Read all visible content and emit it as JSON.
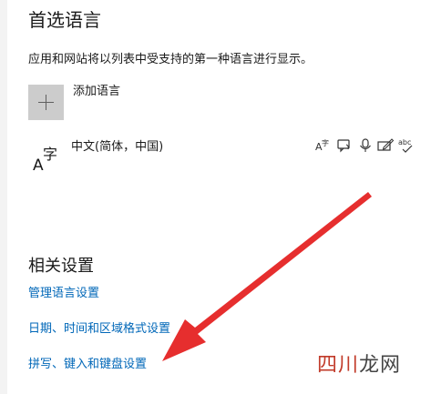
{
  "preferred_languages": {
    "title": "首选语言",
    "description": "应用和网站将以列表中受支持的第一种语言进行显示。",
    "add_language_label": "添加语言"
  },
  "language_item": {
    "name": "中文(简体，中国)",
    "icon_glyphs": {
      "latin": "A",
      "cjk": "字"
    },
    "feature_icons": [
      "display-language-icon",
      "speech-icon",
      "voice-input-icon",
      "handwriting-icon",
      "spellcheck-icon"
    ]
  },
  "related_settings": {
    "title": "相关设置",
    "links": [
      "管理语言设置",
      "日期、时间和区域格式设置",
      "拼写、键入和键盘设置"
    ]
  },
  "watermark": {
    "text_red": "四川",
    "text_dark": "龙网"
  },
  "colors": {
    "link": "#0067b8",
    "arrow": "#e62e2e",
    "add_button_bg": "#cccccc"
  }
}
